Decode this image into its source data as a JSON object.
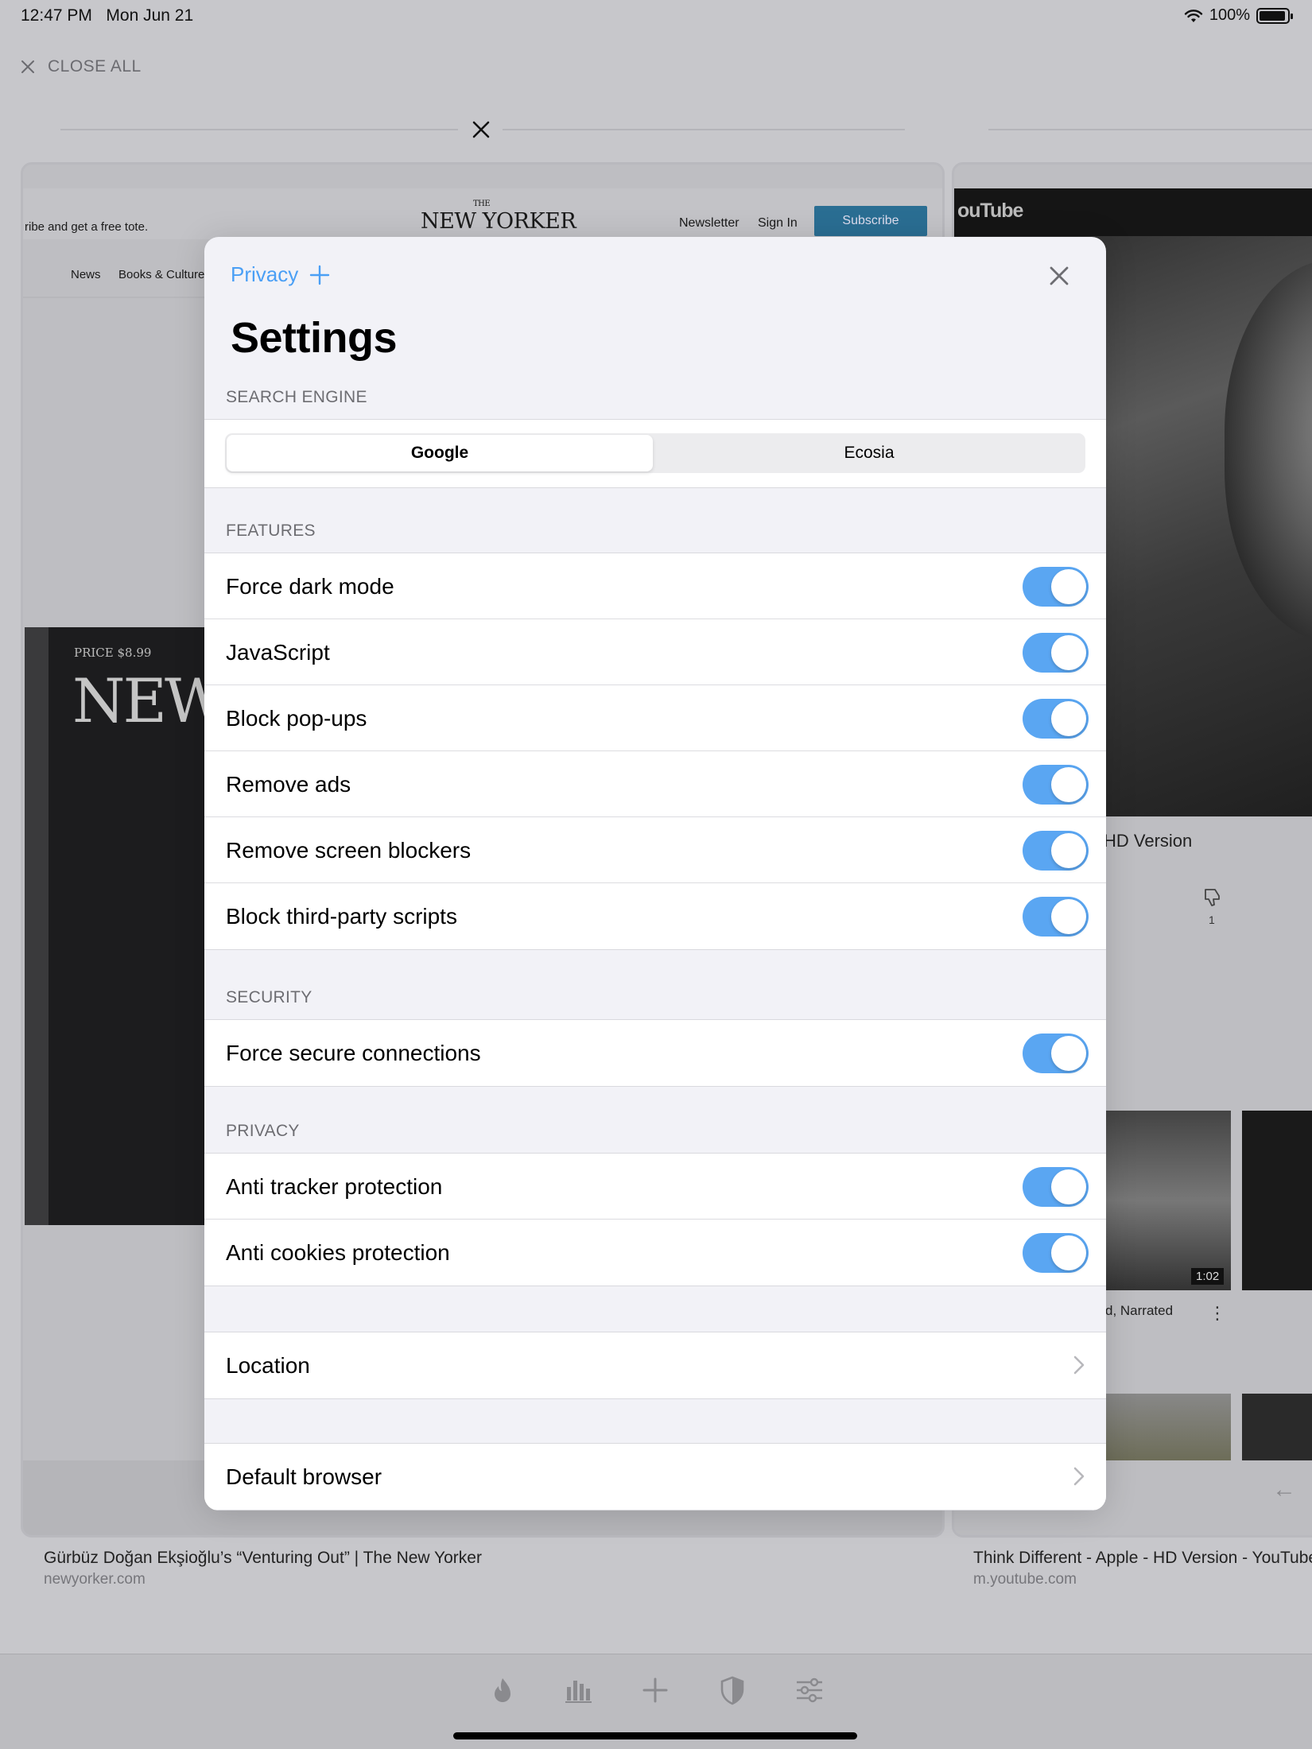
{
  "status_bar": {
    "time": "12:47 PM",
    "date": "Mon Jun 21",
    "battery": "100%"
  },
  "background": {
    "close_all_label": "CLOSE ALL",
    "tabs": [
      {
        "title": "Gürbüz Doğan Ekşioğlu’s “Venturing Out” | The New Yorker",
        "url": "newyorker.com",
        "content": {
          "promo": "ribe and get a free tote.",
          "logo": "NEW YORKER",
          "logo_small": "THE",
          "newsletter": "Newsletter",
          "sign_in": "Sign In",
          "subscribe": "Subscribe",
          "nav_news": "News",
          "nav_books": "Books & Culture",
          "cover_price": "PRICE $8.99",
          "cover_title": "NEW"
        }
      },
      {
        "title": "Think Different - Apple - HD Version - YouTube",
        "url": "m.youtube.com",
        "content": {
          "logo": "ouTube",
          "video_title": "HD Version",
          "dislike_count": "1",
          "duration": "1:02",
          "related_title": "d, Narrated"
        }
      }
    ]
  },
  "settings": {
    "privacy_link": "Privacy",
    "title": "Settings",
    "search_engine": {
      "header": "SEARCH ENGINE",
      "options": [
        "Google",
        "Ecosia"
      ],
      "selected": "Google"
    },
    "features": {
      "header": "FEATURES",
      "items": [
        {
          "label": "Force dark mode",
          "on": true
        },
        {
          "label": "JavaScript",
          "on": true
        },
        {
          "label": "Block pop-ups",
          "on": true
        },
        {
          "label": "Remove ads",
          "on": true
        },
        {
          "label": "Remove screen blockers",
          "on": true
        },
        {
          "label": "Block third-party scripts",
          "on": true
        }
      ]
    },
    "security": {
      "header": "SECURITY",
      "items": [
        {
          "label": "Force secure connections",
          "on": true
        }
      ]
    },
    "privacy": {
      "header": "PRIVACY",
      "items": [
        {
          "label": "Anti tracker protection",
          "on": true
        },
        {
          "label": "Anti cookies protection",
          "on": true
        }
      ]
    },
    "location_label": "Location",
    "default_browser_label": "Default browser"
  },
  "toolbar": {
    "icons": [
      "flame-icon",
      "stats-icon",
      "plus-icon",
      "shield-icon",
      "sliders-icon"
    ]
  },
  "colors": {
    "accent": "#4a9ff5",
    "toggle_on": "#5aa6f2",
    "modal_bg": "#f2f2f7",
    "backdrop": "#c7c7cb"
  }
}
